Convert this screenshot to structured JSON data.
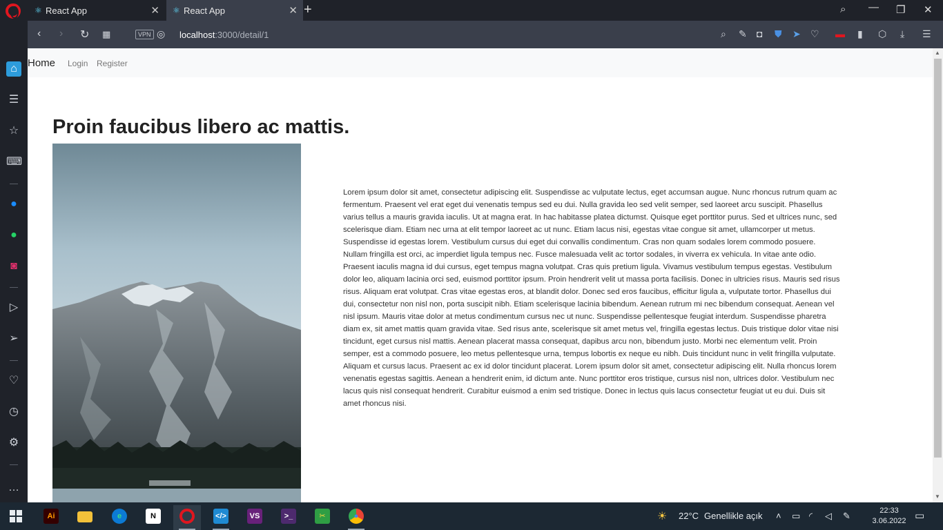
{
  "browser": {
    "tabs": [
      {
        "title": "React App",
        "active": false
      },
      {
        "title": "React App",
        "active": true
      }
    ],
    "url": {
      "host": "localhost",
      "path": ":3000/detail/1"
    },
    "vpn_label": "VPN"
  },
  "navbar": {
    "brand": "Home",
    "links": [
      "Login",
      "Register"
    ]
  },
  "article": {
    "title": "Proin faucibus libero ac mattis.",
    "body": "Lorem ipsum dolor sit amet, consectetur adipiscing elit. Suspendisse ac vulputate lectus, eget accumsan augue. Nunc rhoncus rutrum quam ac fermentum. Praesent vel erat eget dui venenatis tempus sed eu dui. Nulla gravida leo sed velit semper, sed laoreet arcu suscipit. Phasellus varius tellus a mauris gravida iaculis. Ut at magna erat. In hac habitasse platea dictumst. Quisque eget porttitor purus. Sed et ultrices nunc, sed scelerisque diam. Etiam nec urna at elit tempor laoreet ac ut nunc. Etiam lacus nisi, egestas vitae congue sit amet, ullamcorper ut metus. Suspendisse id egestas lorem. Vestibulum cursus dui eget dui convallis condimentum. Cras non quam sodales lorem commodo posuere. Nullam fringilla est orci, ac imperdiet ligula tempus nec. Fusce malesuada velit ac tortor sodales, in viverra ex vehicula. In vitae ante odio. Praesent iaculis magna id dui cursus, eget tempus magna volutpat. Cras quis pretium ligula. Vivamus vestibulum tempus egestas. Vestibulum dolor leo, aliquam lacinia orci sed, euismod porttitor ipsum. Proin hendrerit velit ut massa porta facilisis. Donec in ultricies risus. Mauris sed risus risus. Aliquam erat volutpat. Cras vitae egestas eros, at blandit dolor. Donec sed eros faucibus, efficitur ligula a, vulputate tortor. Phasellus dui dui, consectetur non nisl non, porta suscipit nibh. Etiam scelerisque lacinia bibendum. Aenean rutrum mi nec bibendum consequat. Aenean vel nisl ipsum. Mauris vitae dolor at metus condimentum cursus nec ut nunc. Suspendisse pellentesque feugiat interdum. Suspendisse pharetra diam ex, sit amet mattis quam gravida vitae. Sed risus ante, scelerisque sit amet metus vel, fringilla egestas lectus. Duis tristique dolor vitae nisi tincidunt, eget cursus nisl mattis. Aenean placerat massa consequat, dapibus arcu non, bibendum justo. Morbi nec elementum velit. Proin semper, est a commodo posuere, leo metus pellentesque urna, tempus lobortis ex neque eu nibh. Duis tincidunt nunc in velit fringilla vulputate. Aliquam et cursus lacus. Praesent ac ex id dolor tincidunt placerat. Lorem ipsum dolor sit amet, consectetur adipiscing elit. Nulla rhoncus lorem venenatis egestas sagittis. Aenean a hendrerit enim, id dictum ante. Nunc porttitor eros tristique, cursus nisl non, ultrices dolor. Vestibulum nec lacus quis nisl consequat hendrerit. Curabitur euismod a enim sed tristique. Donec in lectus quis lacus consectetur feugiat ut eu dui. Duis sit amet rhoncus nisi."
  },
  "sidebar_icons": [
    "home-icon",
    "notes-icon",
    "cube-icon",
    "gamepad-icon",
    "messenger-icon",
    "whatsapp-icon",
    "instagram-icon",
    "player-icon",
    "send-icon",
    "heart-icon",
    "history-icon",
    "settings-icon",
    "more-icon"
  ],
  "taskbar": {
    "weather": {
      "temp": "22°C",
      "desc": "Genellikle açık"
    },
    "time": "22:33",
    "date": "3.06.2022"
  },
  "colors": {
    "opera_red": "#e0161f",
    "tab_active": "#3a3f4b",
    "chrome_dark": "#1f2229",
    "taskbar": "#1c2833",
    "navbar_bg": "#f8f9fa"
  }
}
